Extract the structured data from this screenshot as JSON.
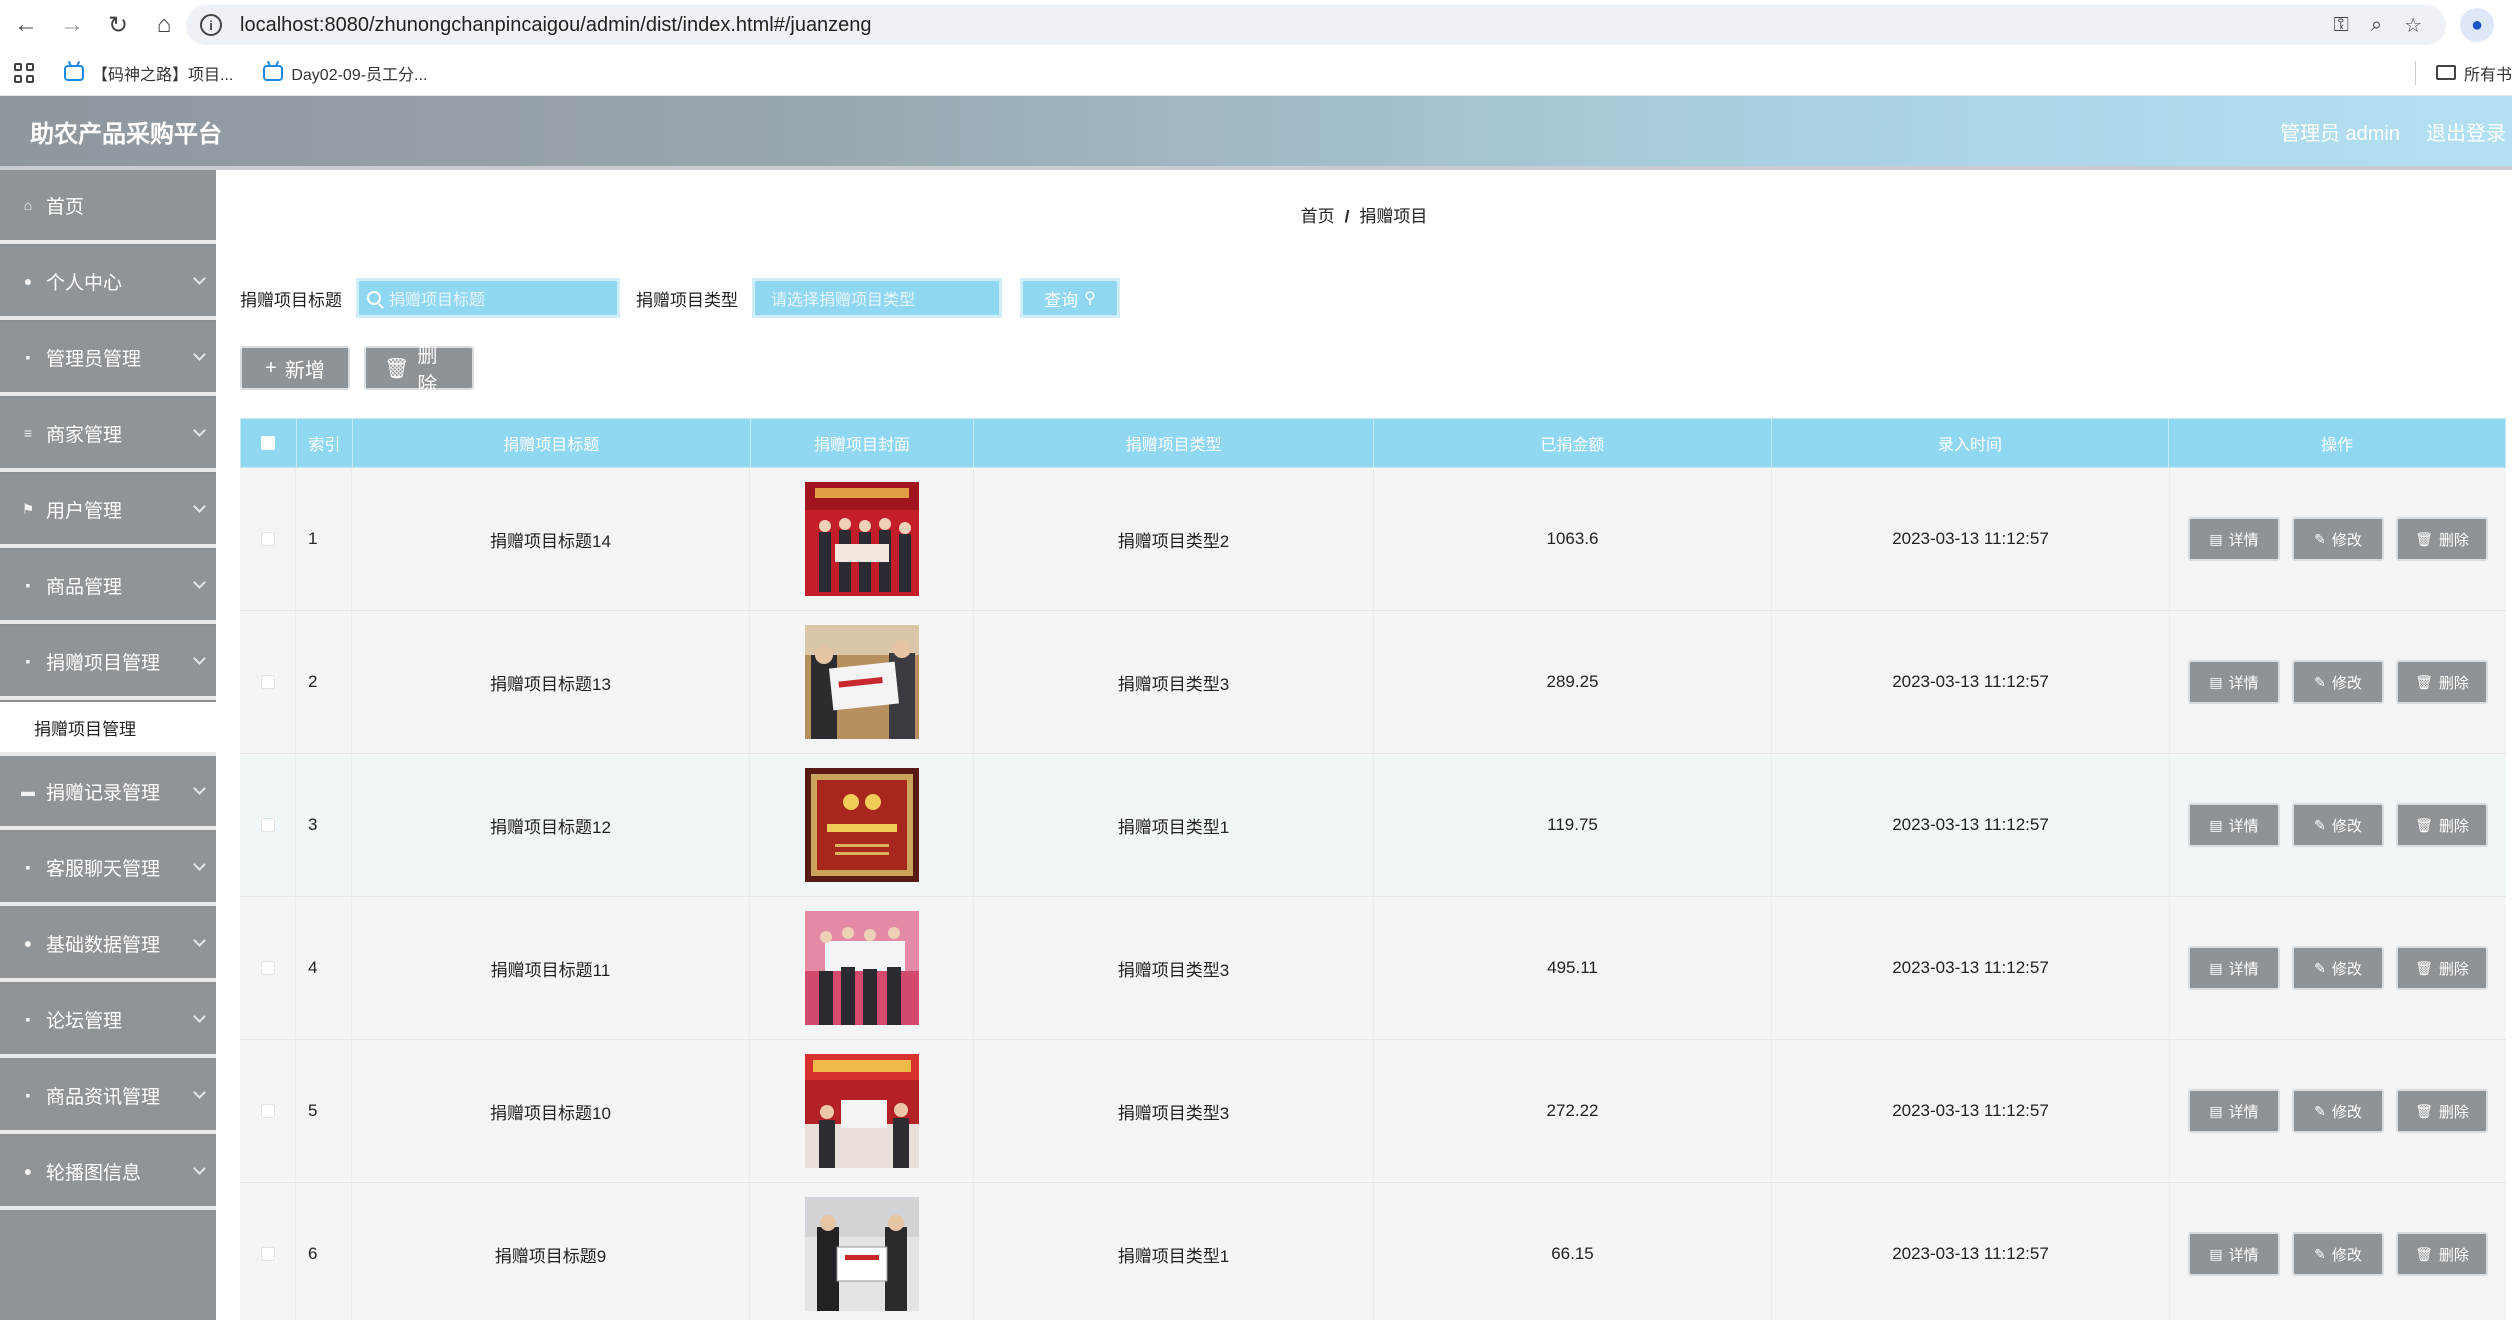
{
  "browser": {
    "url": "localhost:8080/zhunongchanpincaigou/admin/dist/index.html#/juanzeng",
    "bookmarks": [
      "【码神之路】项目...",
      "Day02-09-员工分..."
    ],
    "bookmarks_right": "所有书"
  },
  "app": {
    "title": "助农产品采购平台",
    "user_label": "管理员 admin",
    "logout_label": "退出登录"
  },
  "sidebar": {
    "items": [
      {
        "label": "首页",
        "icon": "home-icon",
        "glyph": "⌂",
        "chevron": false
      },
      {
        "label": "个人中心",
        "icon": "user-icon",
        "glyph": "●",
        "chevron": true
      },
      {
        "label": "管理员管理",
        "icon": "grid-icon",
        "glyph": "▪",
        "chevron": true
      },
      {
        "label": "商家管理",
        "icon": "list-icon",
        "glyph": "≡",
        "chevron": true
      },
      {
        "label": "用户管理",
        "icon": "flag-icon",
        "glyph": "⚑",
        "chevron": true
      },
      {
        "label": "商品管理",
        "icon": "grid-icon",
        "glyph": "▪",
        "chevron": true
      },
      {
        "label": "捐赠项目管理",
        "icon": "grid-icon",
        "glyph": "▪",
        "chevron": true,
        "expanded": true,
        "submenu": "捐赠项目管理"
      },
      {
        "label": "捐赠记录管理",
        "icon": "ticket-icon",
        "glyph": "▬",
        "chevron": true
      },
      {
        "label": "客服聊天管理",
        "icon": "grid-icon",
        "glyph": "▪",
        "chevron": true
      },
      {
        "label": "基础数据管理",
        "icon": "user-icon",
        "glyph": "●",
        "chevron": true
      },
      {
        "label": "论坛管理",
        "icon": "grid-icon",
        "glyph": "▪",
        "chevron": true
      },
      {
        "label": "商品资讯管理",
        "icon": "grid-icon",
        "glyph": "▪",
        "chevron": true
      },
      {
        "label": "轮播图信息",
        "icon": "location-icon",
        "glyph": "●",
        "chevron": true
      }
    ]
  },
  "breadcrumb": {
    "home": "首页",
    "current": "捐赠项目"
  },
  "search": {
    "title_label": "捐赠项目标题",
    "title_placeholder": "捐赠项目标题",
    "type_label": "捐赠项目类型",
    "type_placeholder": "请选择捐赠项目类型",
    "query_label": "查询"
  },
  "actions": {
    "add_label": "新增",
    "delete_label": "删除"
  },
  "table": {
    "headers": {
      "index": "索引",
      "title": "捐赠项目标题",
      "cover": "捐赠项目封面",
      "type": "捐赠项目类型",
      "amount": "已捐金额",
      "time": "录入时间",
      "ops": "操作"
    },
    "op_labels": {
      "detail": "详情",
      "edit": "修改",
      "delete": "删除"
    },
    "rows": [
      {
        "index": "1",
        "title": "捐赠项目标题14",
        "type": "捐赠项目类型2",
        "amount": "1063.6",
        "time": "2023-03-13 11:12:57"
      },
      {
        "index": "2",
        "title": "捐赠项目标题13",
        "type": "捐赠项目类型3",
        "amount": "289.25",
        "time": "2023-03-13 11:12:57"
      },
      {
        "index": "3",
        "title": "捐赠项目标题12",
        "type": "捐赠项目类型1",
        "amount": "119.75",
        "time": "2023-03-13 11:12:57"
      },
      {
        "index": "4",
        "title": "捐赠项目标题11",
        "type": "捐赠项目类型3",
        "amount": "495.11",
        "time": "2023-03-13 11:12:57"
      },
      {
        "index": "5",
        "title": "捐赠项目标题10",
        "type": "捐赠项目类型3",
        "amount": "272.22",
        "time": "2023-03-13 11:12:57"
      },
      {
        "index": "6",
        "title": "捐赠项目标题9",
        "type": "捐赠项目类型1",
        "amount": "66.15",
        "time": "2023-03-13 11:12:57"
      }
    ]
  },
  "colors": {
    "accent": "#90d7f2",
    "button_gray": "#8e9397",
    "sidebar": "#8f9499"
  }
}
